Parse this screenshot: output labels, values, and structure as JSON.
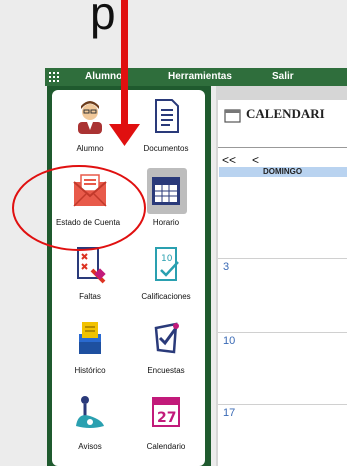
{
  "top": {
    "partial_text": "p"
  },
  "menubar": {
    "items": [
      "Alumnos",
      "Herramientas",
      "Salir"
    ]
  },
  "sidebar": {
    "tiles": [
      {
        "label": "Alumno",
        "icon": "student-icon"
      },
      {
        "label": "Documentos",
        "icon": "documents-icon"
      },
      {
        "label": "Estado de Cuenta",
        "icon": "envelope-icon"
      },
      {
        "label": "Horario",
        "icon": "calendar-schedule-icon",
        "selected": true
      },
      {
        "label": "Faltas",
        "icon": "absences-icon"
      },
      {
        "label": "Calificaciones",
        "icon": "grades-icon"
      },
      {
        "label": "Histórico",
        "icon": "history-icon"
      },
      {
        "label": "Encuestas",
        "icon": "surveys-icon"
      },
      {
        "label": "Avisos",
        "icon": "notices-icon"
      },
      {
        "label": "Calendario",
        "icon": "calendar-icon"
      }
    ]
  },
  "calendar": {
    "title": "CALENDARI",
    "nav_prev_year": "<<",
    "nav_prev": "<",
    "day_header": "DOMINGO",
    "days": [
      "3",
      "10",
      "17"
    ],
    "calendar_icon_text": "27"
  },
  "annotation": {
    "arrow_color": "#e01010",
    "circle_color": "#e01010"
  }
}
